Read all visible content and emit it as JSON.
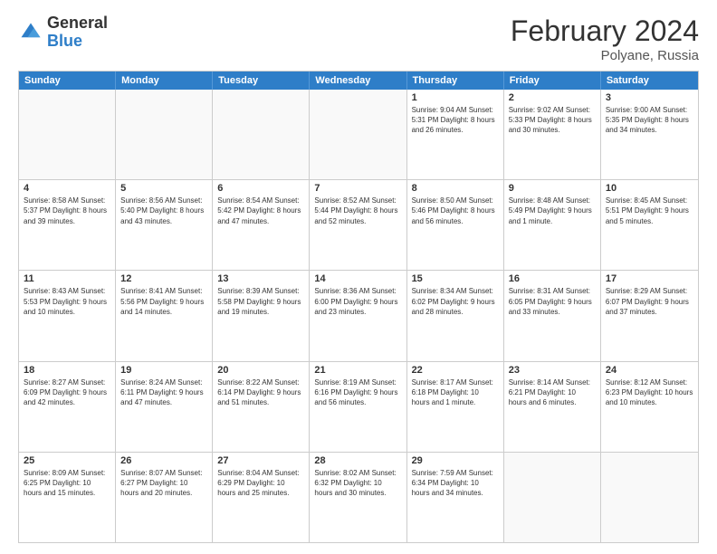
{
  "logo": {
    "general": "General",
    "blue": "Blue"
  },
  "title": "February 2024",
  "location": "Polyane, Russia",
  "days_of_week": [
    "Sunday",
    "Monday",
    "Tuesday",
    "Wednesday",
    "Thursday",
    "Friday",
    "Saturday"
  ],
  "weeks": [
    [
      {
        "day": "",
        "info": "",
        "empty": true
      },
      {
        "day": "",
        "info": "",
        "empty": true
      },
      {
        "day": "",
        "info": "",
        "empty": true
      },
      {
        "day": "",
        "info": "",
        "empty": true
      },
      {
        "day": "1",
        "info": "Sunrise: 9:04 AM\nSunset: 5:31 PM\nDaylight: 8 hours\nand 26 minutes.",
        "empty": false
      },
      {
        "day": "2",
        "info": "Sunrise: 9:02 AM\nSunset: 5:33 PM\nDaylight: 8 hours\nand 30 minutes.",
        "empty": false
      },
      {
        "day": "3",
        "info": "Sunrise: 9:00 AM\nSunset: 5:35 PM\nDaylight: 8 hours\nand 34 minutes.",
        "empty": false
      }
    ],
    [
      {
        "day": "4",
        "info": "Sunrise: 8:58 AM\nSunset: 5:37 PM\nDaylight: 8 hours\nand 39 minutes.",
        "empty": false
      },
      {
        "day": "5",
        "info": "Sunrise: 8:56 AM\nSunset: 5:40 PM\nDaylight: 8 hours\nand 43 minutes.",
        "empty": false
      },
      {
        "day": "6",
        "info": "Sunrise: 8:54 AM\nSunset: 5:42 PM\nDaylight: 8 hours\nand 47 minutes.",
        "empty": false
      },
      {
        "day": "7",
        "info": "Sunrise: 8:52 AM\nSunset: 5:44 PM\nDaylight: 8 hours\nand 52 minutes.",
        "empty": false
      },
      {
        "day": "8",
        "info": "Sunrise: 8:50 AM\nSunset: 5:46 PM\nDaylight: 8 hours\nand 56 minutes.",
        "empty": false
      },
      {
        "day": "9",
        "info": "Sunrise: 8:48 AM\nSunset: 5:49 PM\nDaylight: 9 hours\nand 1 minute.",
        "empty": false
      },
      {
        "day": "10",
        "info": "Sunrise: 8:45 AM\nSunset: 5:51 PM\nDaylight: 9 hours\nand 5 minutes.",
        "empty": false
      }
    ],
    [
      {
        "day": "11",
        "info": "Sunrise: 8:43 AM\nSunset: 5:53 PM\nDaylight: 9 hours\nand 10 minutes.",
        "empty": false
      },
      {
        "day": "12",
        "info": "Sunrise: 8:41 AM\nSunset: 5:56 PM\nDaylight: 9 hours\nand 14 minutes.",
        "empty": false
      },
      {
        "day": "13",
        "info": "Sunrise: 8:39 AM\nSunset: 5:58 PM\nDaylight: 9 hours\nand 19 minutes.",
        "empty": false
      },
      {
        "day": "14",
        "info": "Sunrise: 8:36 AM\nSunset: 6:00 PM\nDaylight: 9 hours\nand 23 minutes.",
        "empty": false
      },
      {
        "day": "15",
        "info": "Sunrise: 8:34 AM\nSunset: 6:02 PM\nDaylight: 9 hours\nand 28 minutes.",
        "empty": false
      },
      {
        "day": "16",
        "info": "Sunrise: 8:31 AM\nSunset: 6:05 PM\nDaylight: 9 hours\nand 33 minutes.",
        "empty": false
      },
      {
        "day": "17",
        "info": "Sunrise: 8:29 AM\nSunset: 6:07 PM\nDaylight: 9 hours\nand 37 minutes.",
        "empty": false
      }
    ],
    [
      {
        "day": "18",
        "info": "Sunrise: 8:27 AM\nSunset: 6:09 PM\nDaylight: 9 hours\nand 42 minutes.",
        "empty": false
      },
      {
        "day": "19",
        "info": "Sunrise: 8:24 AM\nSunset: 6:11 PM\nDaylight: 9 hours\nand 47 minutes.",
        "empty": false
      },
      {
        "day": "20",
        "info": "Sunrise: 8:22 AM\nSunset: 6:14 PM\nDaylight: 9 hours\nand 51 minutes.",
        "empty": false
      },
      {
        "day": "21",
        "info": "Sunrise: 8:19 AM\nSunset: 6:16 PM\nDaylight: 9 hours\nand 56 minutes.",
        "empty": false
      },
      {
        "day": "22",
        "info": "Sunrise: 8:17 AM\nSunset: 6:18 PM\nDaylight: 10 hours\nand 1 minute.",
        "empty": false
      },
      {
        "day": "23",
        "info": "Sunrise: 8:14 AM\nSunset: 6:21 PM\nDaylight: 10 hours\nand 6 minutes.",
        "empty": false
      },
      {
        "day": "24",
        "info": "Sunrise: 8:12 AM\nSunset: 6:23 PM\nDaylight: 10 hours\nand 10 minutes.",
        "empty": false
      }
    ],
    [
      {
        "day": "25",
        "info": "Sunrise: 8:09 AM\nSunset: 6:25 PM\nDaylight: 10 hours\nand 15 minutes.",
        "empty": false
      },
      {
        "day": "26",
        "info": "Sunrise: 8:07 AM\nSunset: 6:27 PM\nDaylight: 10 hours\nand 20 minutes.",
        "empty": false
      },
      {
        "day": "27",
        "info": "Sunrise: 8:04 AM\nSunset: 6:29 PM\nDaylight: 10 hours\nand 25 minutes.",
        "empty": false
      },
      {
        "day": "28",
        "info": "Sunrise: 8:02 AM\nSunset: 6:32 PM\nDaylight: 10 hours\nand 30 minutes.",
        "empty": false
      },
      {
        "day": "29",
        "info": "Sunrise: 7:59 AM\nSunset: 6:34 PM\nDaylight: 10 hours\nand 34 minutes.",
        "empty": false
      },
      {
        "day": "",
        "info": "",
        "empty": true
      },
      {
        "day": "",
        "info": "",
        "empty": true
      }
    ]
  ]
}
